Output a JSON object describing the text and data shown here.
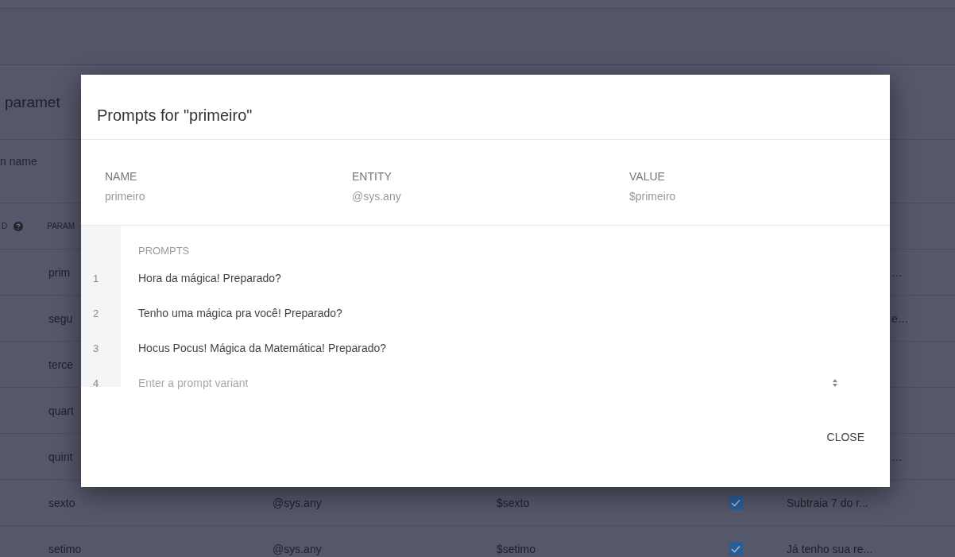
{
  "page": {
    "title": "paramet",
    "search_placeholder": "n name",
    "header": {
      "column_1": "D",
      "column_2": "PARAM"
    },
    "rows": [
      {
        "name": "prim",
        "prompt_tail": "…"
      },
      {
        "name": "segu",
        "prompt_tail": "e…"
      },
      {
        "name": "terce"
      },
      {
        "name": "quart"
      },
      {
        "name": "quint",
        "prompt_tail": "…"
      },
      {
        "name": "sexto",
        "entity": "@sys.any",
        "value": "$sexto",
        "checked": true,
        "prompt": "Subtraia 7 do r..."
      },
      {
        "name": "setimo",
        "entity": "@sys.any",
        "value": "$setimo",
        "checked": true,
        "prompt": "Já tenho sua re..."
      }
    ]
  },
  "dialog": {
    "title": "Prompts for \"primeiro\"",
    "fields": [
      {
        "label": "NAME",
        "value": "primeiro"
      },
      {
        "label": "ENTITY",
        "value": "@sys.any"
      },
      {
        "label": "VALUE",
        "value": "$primeiro"
      }
    ],
    "prompts_label": "PROMPTS",
    "prompts": [
      {
        "number": "1",
        "text": "Hora da mágica! Preparado?"
      },
      {
        "number": "2",
        "text": "Tenho uma mágica pra você! Preparado?"
      },
      {
        "number": "3",
        "text": "Hocus Pocus! Mágica da Matemática! Preparado?"
      }
    ],
    "new_prompt": {
      "number": "4",
      "placeholder": "Enter a prompt variant"
    },
    "close": "CLOSE"
  }
}
